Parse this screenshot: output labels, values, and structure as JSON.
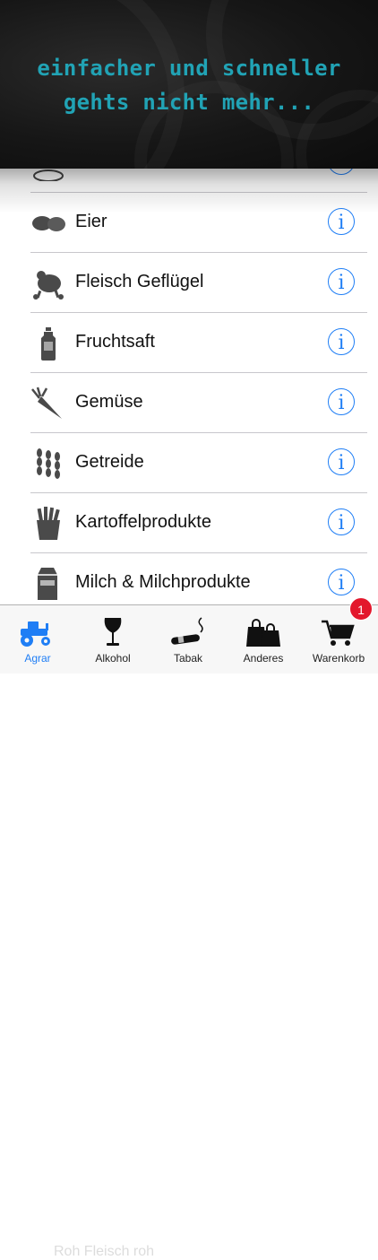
{
  "banner": {
    "line1": "einfacher und schneller",
    "line2": "gehts nicht mehr..."
  },
  "list": {
    "items": [
      {
        "label": "",
        "icon": "partial-icon"
      },
      {
        "label": "Eier",
        "icon": "eggs-icon"
      },
      {
        "label": "Fleisch Geflügel",
        "icon": "poultry-icon"
      },
      {
        "label": "Fruchtsaft",
        "icon": "bottle-icon"
      },
      {
        "label": "Gemüse",
        "icon": "carrot-icon"
      },
      {
        "label": "Getreide",
        "icon": "grain-icon"
      },
      {
        "label": "Kartoffelprodukte",
        "icon": "fries-icon"
      },
      {
        "label": "Milch & Milchprodukte",
        "icon": "milk-carton-icon"
      }
    ],
    "info_symbol": "i",
    "ghost_text": "Roh Fleisch roh"
  },
  "tabbar": {
    "tabs": [
      {
        "label": "Agrar",
        "icon": "tractor-icon",
        "active": true
      },
      {
        "label": "Alkohol",
        "icon": "wine-glass-icon",
        "active": false
      },
      {
        "label": "Tabak",
        "icon": "cigar-icon",
        "active": false
      },
      {
        "label": "Anderes",
        "icon": "shopping-bags-icon",
        "active": false
      },
      {
        "label": "Warenkorb",
        "icon": "cart-icon",
        "active": false
      }
    ],
    "cart_badge": "1"
  },
  "colors": {
    "accent": "#1f7ef5",
    "tagline": "#21a3b5",
    "badge": "#e3172c"
  }
}
